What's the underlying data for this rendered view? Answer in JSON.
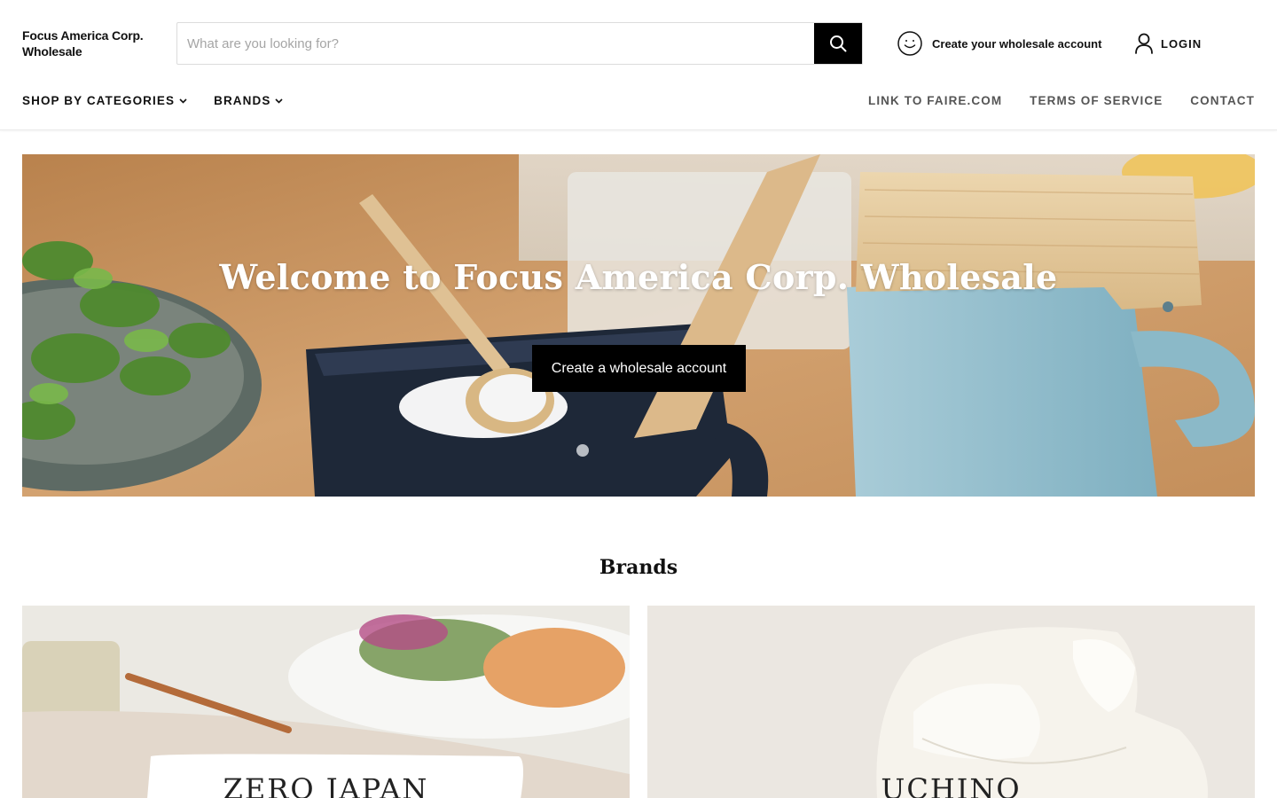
{
  "header": {
    "logo_text": "Focus America Corp. Wholesale",
    "search": {
      "placeholder": "What are you looking for?"
    },
    "account_link": "Create your wholesale account",
    "login_link": "LOGIN"
  },
  "nav": {
    "left": [
      {
        "label": "SHOP BY CATEGORIES"
      },
      {
        "label": "BRANDS"
      }
    ],
    "right": [
      {
        "label": "LINK TO FAIRE.COM"
      },
      {
        "label": "TERMS OF SERVICE"
      },
      {
        "label": "CONTACT"
      }
    ]
  },
  "hero": {
    "title": "Welcome to Focus America Corp. Wholesale",
    "button_label": "Create a wholesale account"
  },
  "brands": {
    "title": "Brands",
    "cards": [
      {
        "label": "ZERO JAPAN"
      },
      {
        "label": "UCHINO"
      }
    ]
  },
  "colors": {
    "accent": "#000000",
    "nav_secondary": "#555555"
  },
  "icons": {
    "search": "search-icon",
    "account": "smiley-icon",
    "login": "user-icon",
    "dropdown": "chevron-down-icon"
  }
}
